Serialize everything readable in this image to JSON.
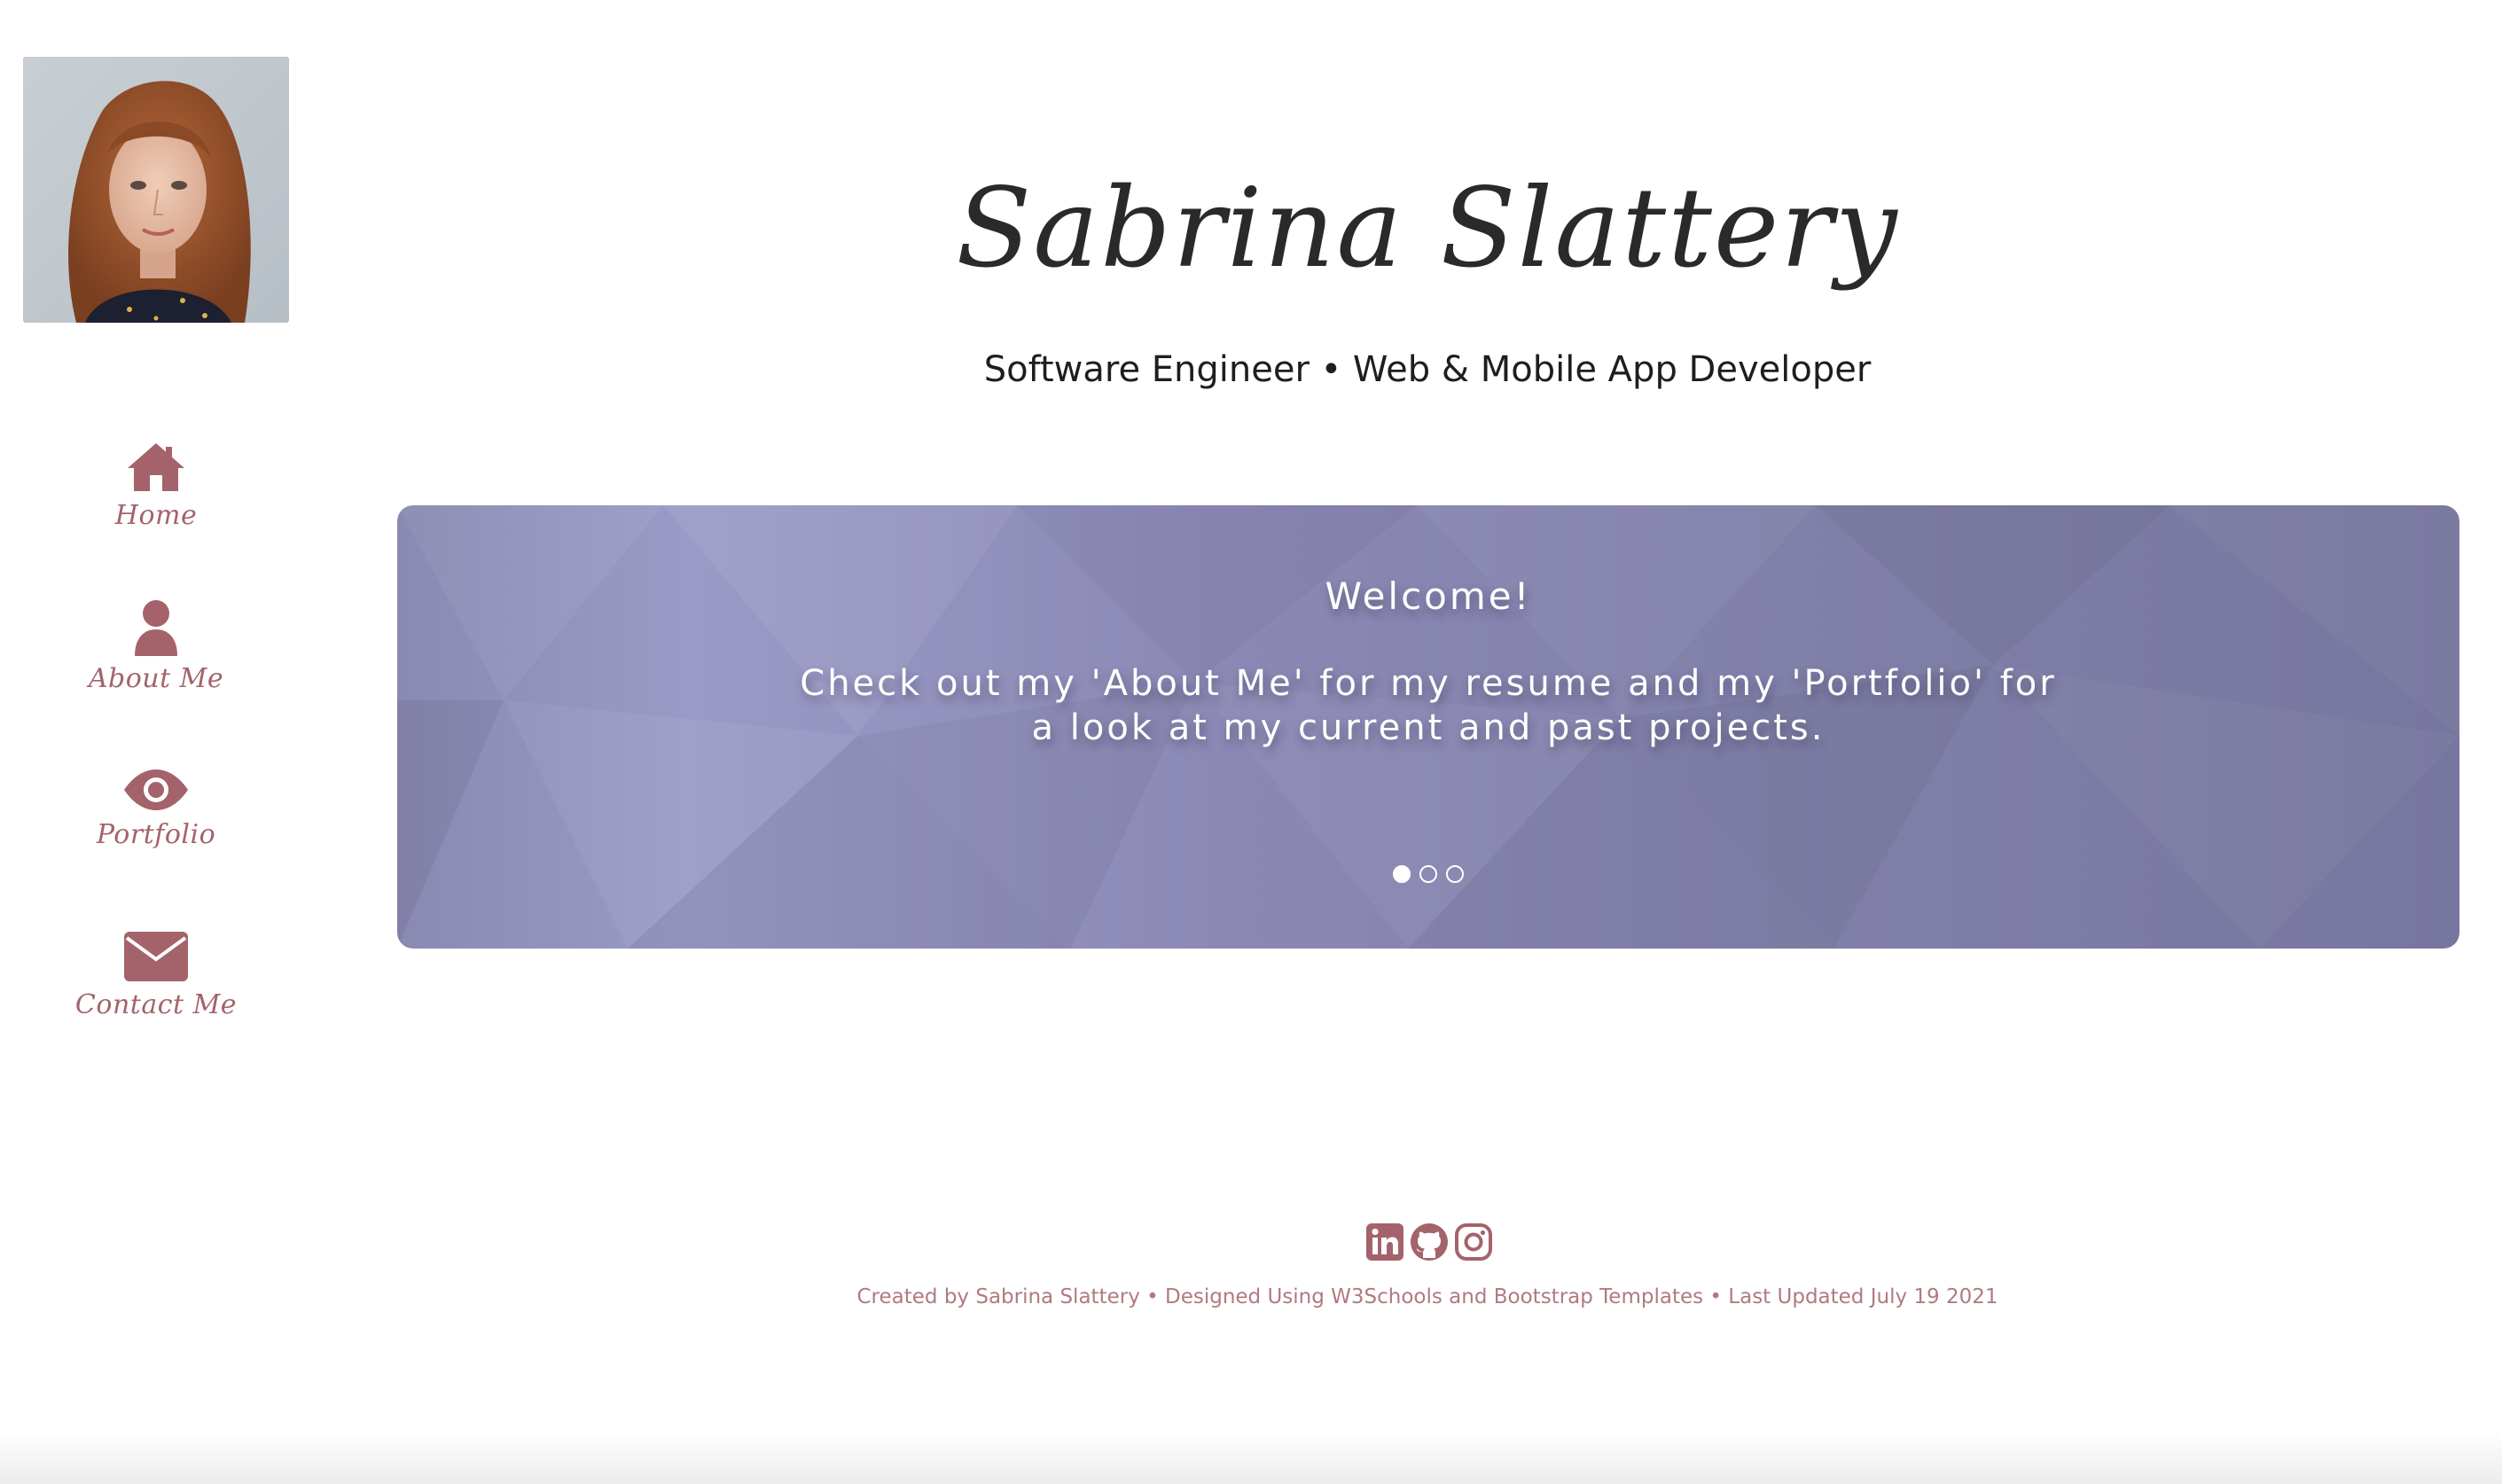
{
  "sidebar": {
    "photo_alt": "Sabrina Slattery",
    "items": [
      {
        "label": "Home",
        "icon": "home-icon"
      },
      {
        "label": "About Me",
        "icon": "user-icon"
      },
      {
        "label": "Portfolio",
        "icon": "eye-icon"
      },
      {
        "label": "Contact Me",
        "icon": "envelope-icon"
      }
    ]
  },
  "header": {
    "name": "Sabrina Slattery",
    "subtitle": "Software Engineer • Web & Mobile App Developer"
  },
  "carousel": {
    "title": "Welcome!",
    "message": "Check out my 'About Me' for my resume and my 'Portfolio' for a look at my current and past projects.",
    "slide_count": 3,
    "active_slide": 1
  },
  "footer": {
    "social": [
      "linkedin-icon",
      "github-icon",
      "instagram-icon"
    ],
    "text": "Created by Sabrina Slattery • Designed Using W3Schools and Bootstrap Templates • Last Updated July 19 2021"
  },
  "colors": {
    "accent": "#a4636a",
    "footer_text": "#b07a7f",
    "carousel_bg": "#8b89b4",
    "text_dark": "#2a2a2a"
  }
}
